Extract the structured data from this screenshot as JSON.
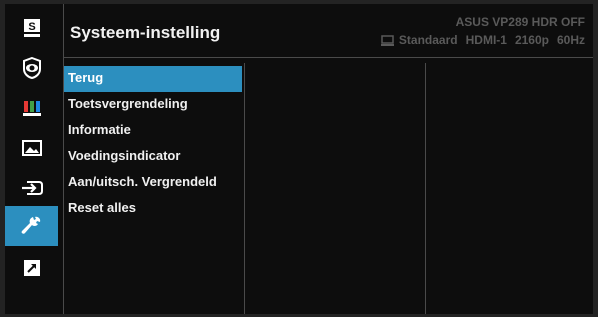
{
  "sidebar": {
    "items": [
      {
        "icon": "splendid-s-icon",
        "label": "Splendid"
      },
      {
        "icon": "eye-icon",
        "label": "Blue Light Filter"
      },
      {
        "icon": "color-bars-icon",
        "label": "Color"
      },
      {
        "icon": "image-icon",
        "label": "Image"
      },
      {
        "icon": "input-select-icon",
        "label": "Input Select"
      },
      {
        "icon": "wrench-icon",
        "label": "System Setup",
        "active": true
      },
      {
        "icon": "shortcut-arrow-icon",
        "label": "Shortcut"
      }
    ]
  },
  "header": {
    "title": "Systeem-instelling",
    "model": "ASUS  VP289 HDR OFF",
    "status": {
      "mode": "Standaard",
      "input": "HDMI-1",
      "resolution": "2160p",
      "refresh": "60Hz"
    }
  },
  "menu": {
    "items": [
      {
        "label": "Terug",
        "selected": true
      },
      {
        "label": "Toetsvergrendeling"
      },
      {
        "label": "Informatie"
      },
      {
        "label": "Voedingsindicator"
      },
      {
        "label": "Aan/uitsch. Vergrendeld"
      },
      {
        "label": "Reset alles"
      }
    ]
  },
  "colors": {
    "accent": "#2c8fbf",
    "background": "#0d0d0d",
    "text": "#f0f0f0",
    "muted": "#5a5a5a"
  }
}
